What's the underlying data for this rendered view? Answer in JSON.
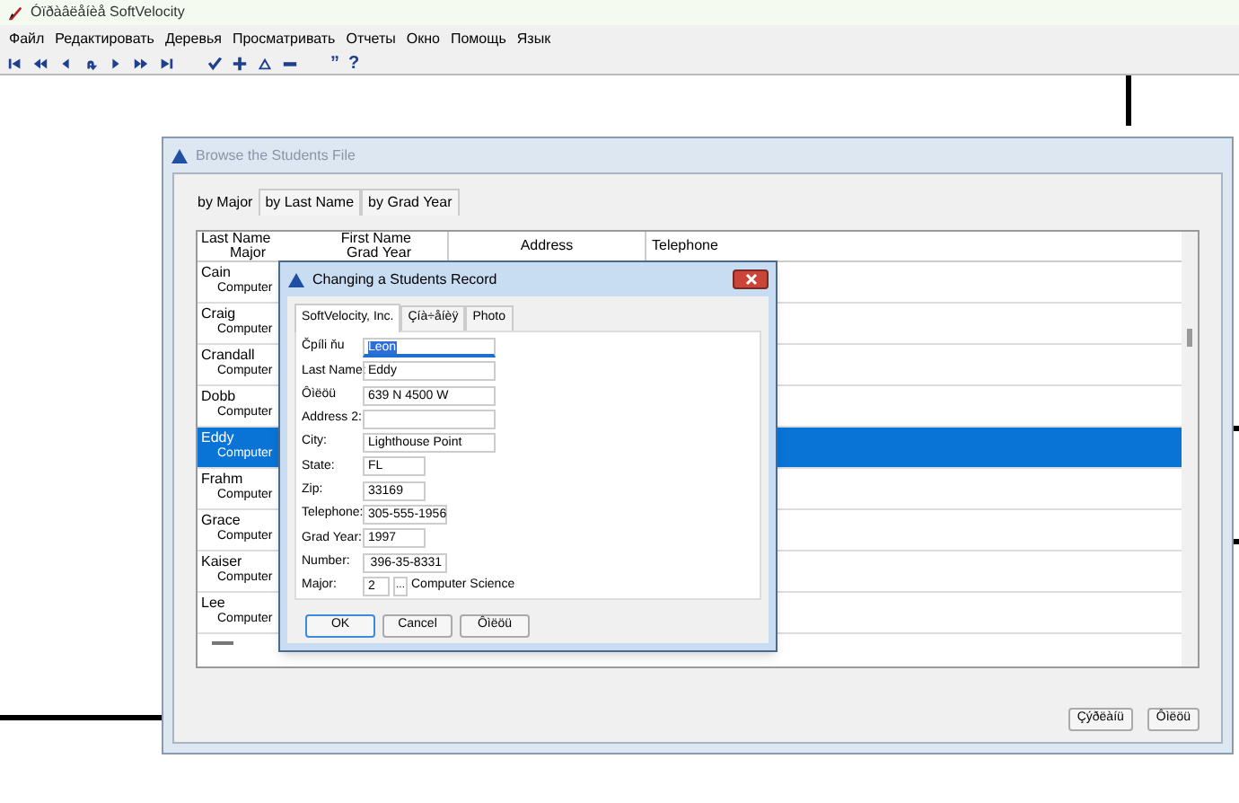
{
  "window": {
    "title": "Óïðàâëåíèå SoftVelocity"
  },
  "menu": [
    "Файл",
    "Редактировать",
    "Деревья",
    "Просматривать",
    "Отчеты",
    "Окно",
    "Помощь",
    "Язык"
  ],
  "toolbar": [
    {
      "kind": "first"
    },
    {
      "kind": "prev-page"
    },
    {
      "kind": "prev"
    },
    {
      "kind": "redo"
    },
    {
      "kind": "next"
    },
    {
      "kind": "next-page"
    },
    {
      "kind": "last"
    },
    {
      "kind": "gap"
    },
    {
      "kind": "check"
    },
    {
      "kind": "plus"
    },
    {
      "kind": "triangle"
    },
    {
      "kind": "minus"
    },
    {
      "kind": "gap"
    },
    {
      "kind": "text",
      "text": "”"
    },
    {
      "kind": "text",
      "text": "?"
    }
  ],
  "browse": {
    "title": "Browse the Students File",
    "tabs": [
      {
        "label": "by Major",
        "selected": true
      },
      {
        "label": "by Last Name",
        "selected": false
      },
      {
        "label": "by Grad Year",
        "selected": false
      }
    ],
    "columns": [
      {
        "line1": "Last Name",
        "line2": "Major"
      },
      {
        "line1": "First Name",
        "line2": "Grad Year"
      },
      {
        "line1": "Address"
      },
      {
        "line1": "Telephone"
      }
    ],
    "rows": [
      {
        "name": "Cain",
        "major": "Computer",
        "selected": false
      },
      {
        "name": "Craig",
        "major": "Computer",
        "selected": false
      },
      {
        "name": "Crandall",
        "major": "Computer",
        "selected": false
      },
      {
        "name": "Dobb",
        "major": "Computer",
        "selected": false
      },
      {
        "name": "Eddy",
        "major": "Computer",
        "selected": true
      },
      {
        "name": "Frahm",
        "major": "Computer",
        "selected": false
      },
      {
        "name": "Grace",
        "major": "Computer",
        "selected": false
      },
      {
        "name": "Kaiser",
        "major": "Computer",
        "selected": false
      },
      {
        "name": "Lee",
        "major": "Computer",
        "selected": false
      }
    ],
    "buttons": [
      "Çýðëàíü",
      "Ôìëöü"
    ]
  },
  "dialog": {
    "title": "Changing a Students Record",
    "tabs": [
      {
        "label": "SoftVelocity, Inc.",
        "selected": true
      },
      {
        "label": "Çíà÷åíèÿ",
        "selected": false
      },
      {
        "label": "Photo",
        "selected": false
      }
    ],
    "fields": [
      {
        "kind": "wide",
        "label": "Čpíli ňu",
        "value": "Leon",
        "focused": true
      },
      {
        "kind": "wide",
        "label": "Last Name:",
        "value": "Eddy",
        "focused": false
      },
      {
        "kind": "wide",
        "label": "Ôìëöü",
        "value": "639 N 4500 W",
        "focused": false
      },
      {
        "kind": "wide",
        "label": "Address 2:",
        "focused": false
      },
      {
        "kind": "wide",
        "label": "City:",
        "value": "Lighthouse Point",
        "focused": false
      },
      {
        "kind": "narrow",
        "label": "State:",
        "value": "FL",
        "focused": false
      },
      {
        "kind": "narrow",
        "label": "Zip:",
        "value": "33169",
        "focused": false
      },
      {
        "kind": "medium",
        "label": "Telephone:",
        "value": "305-555-1956",
        "focused": false
      },
      {
        "kind": "narrow",
        "label": "Grad Year:",
        "value": "1997",
        "focused": false
      },
      {
        "kind": "number",
        "label": "Number:",
        "value": "396-35-8331",
        "focused": false
      },
      {
        "kind": "lookup",
        "label": "Major:",
        "value": "2",
        "button": "...",
        "description": "Computer Science"
      }
    ],
    "buttons": [
      {
        "label": "OK",
        "default": true
      },
      {
        "label": "Cancel",
        "default": false
      },
      {
        "label": "Ôìëöü",
        "default": false
      }
    ]
  }
}
